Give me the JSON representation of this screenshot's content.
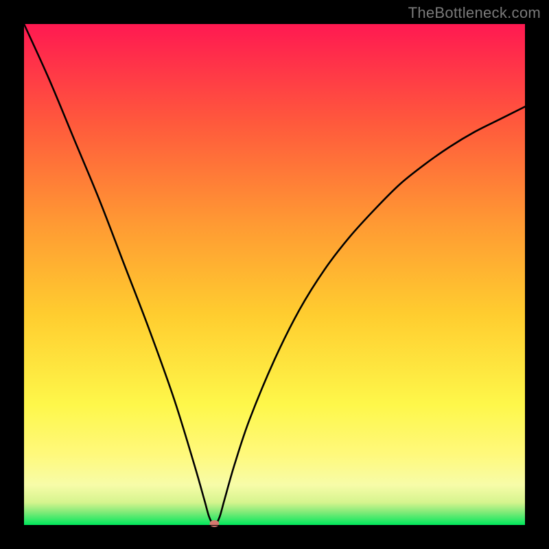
{
  "meta": {
    "watermark": "TheBottleneck.com"
  },
  "chart_data": {
    "type": "line",
    "title": "",
    "xlabel": "",
    "ylabel": "",
    "x_range": [
      0,
      100
    ],
    "y_range": [
      0,
      100
    ],
    "background_gradient": {
      "top": "#ff1951",
      "mid": "#ffcd2f",
      "low": "#fff97c",
      "band": "#f7fca8",
      "bottom": "#00e85c"
    },
    "plot_inner_fraction": {
      "x": 0.9,
      "y": 0.9
    },
    "curve": {
      "name": "bottleneck-curve",
      "min_x": 38,
      "approx_points_x": [
        0,
        5,
        10,
        15,
        20,
        25,
        30,
        34,
        36,
        37,
        38,
        39,
        40,
        42,
        45,
        50,
        55,
        60,
        65,
        70,
        75,
        80,
        85,
        90,
        95,
        100
      ],
      "approx_points_y": [
        100,
        89,
        77,
        65,
        52,
        39,
        25,
        12,
        5,
        1.5,
        0,
        1.5,
        5,
        12,
        21,
        33,
        43,
        51,
        57.5,
        63,
        68,
        72,
        75.5,
        78.5,
        81,
        83.5
      ]
    },
    "marker": {
      "x": 38,
      "y": 0,
      "color": "#d6776f",
      "rx": 7,
      "ry": 5
    }
  }
}
